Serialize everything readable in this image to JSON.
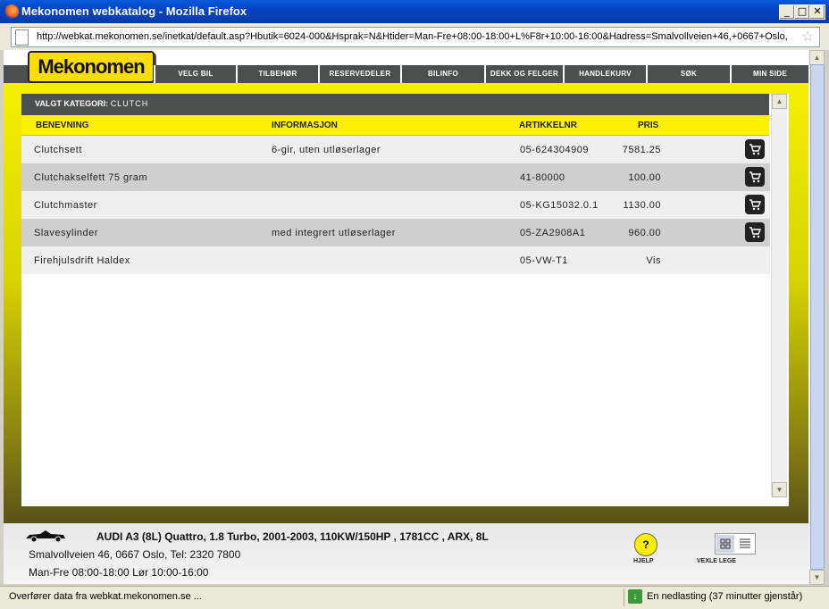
{
  "window": {
    "title": "Mekonomen webkatalog - Mozilla Firefox",
    "btn_min": "_",
    "btn_max": "□",
    "btn_close": "✕"
  },
  "address": {
    "url": "http://webkat.mekonomen.se/inetkat/default.asp?Hbutik=6024-000&Hsprak=N&Htider=Man-Fre+08:00-18:00+L%F8r+10:00-16:00&Hadress=Smalvollveien+46,+0667+Oslo,"
  },
  "brand": {
    "logo_text": "Mekonomen"
  },
  "nav": [
    "VELG BIL",
    "TILBEHØR",
    "RESERVEDELER",
    "BILINFO",
    "DEKK OG FELGER",
    "HANDLEKURV",
    "SØK",
    "MIN SIDE"
  ],
  "catalog": {
    "category_label": "VALGT KATEGORI:",
    "category_value": "CLUTCH",
    "columns": {
      "name": "BENEVNING",
      "info": "INFORMASJON",
      "article": "ARTIKKELNR",
      "price": "PRIS"
    },
    "rows": [
      {
        "name": "Clutchsett",
        "info": "6-gir, uten utløserlager",
        "article": "05-624304909",
        "price": "7581.25",
        "cart": true
      },
      {
        "name": "Clutchakselfett 75 gram",
        "info": "",
        "article": "41-80000",
        "price": "100.00",
        "cart": true
      },
      {
        "name": "Clutchmaster",
        "info": "",
        "article": "05-KG15032.0.1",
        "price": "1130.00",
        "cart": true
      },
      {
        "name": "Slavesylinder",
        "info": "med integrert utløserlager",
        "article": "05-ZA2908A1",
        "price": "960.00",
        "cart": true
      },
      {
        "name": "Firehjulsdrift Haldex",
        "info": "",
        "article": "05-VW-T1",
        "price": "Vis",
        "cart": false
      }
    ]
  },
  "footer": {
    "vehicle": "AUDI A3 (8L) Quattro, 1.8 Turbo, 2001-2003, 110KW/150HP , 1781CC , ARX, 8L",
    "address": "Smalvollveien 46, 0667 Oslo, Tel: 2320 7800",
    "hours": "Man-Fre 08:00-18:00 Lør 10:00-16:00",
    "help_label": "HJELP",
    "help_symbol": "?",
    "toggle_label": "VEXLE LEGE"
  },
  "status": {
    "left": "Overfører data fra webkat.mekonomen.se ...",
    "right": "En nedlasting (37 minutter gjenstår)"
  },
  "colors": {
    "accent_yellow": "#fff200",
    "nav_dark": "#4a4f52",
    "titlebar_blue": "#0343c3"
  }
}
